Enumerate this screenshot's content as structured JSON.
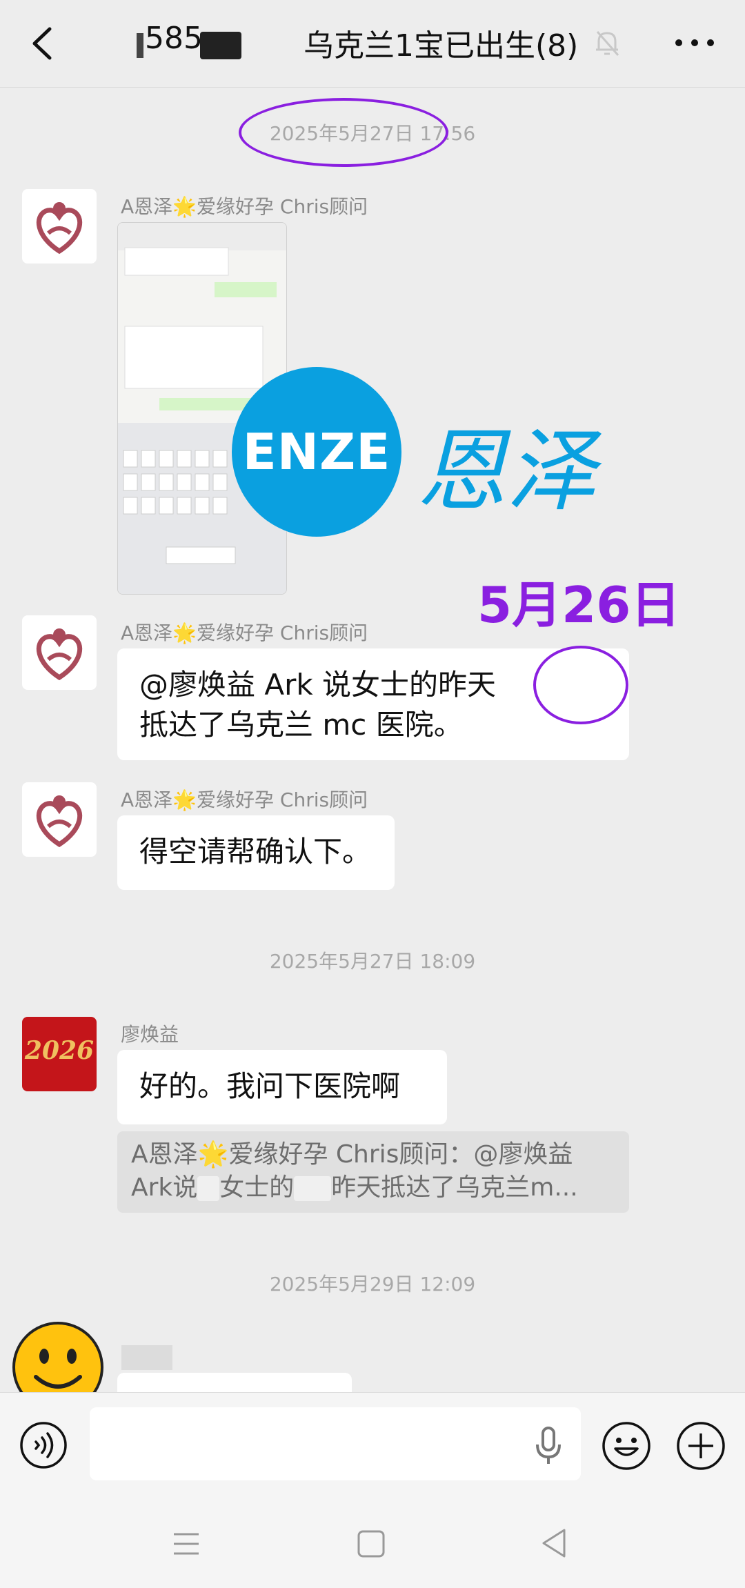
{
  "header": {
    "group_id_partial": "585",
    "group_title": "乌克兰1宝已出生(8)"
  },
  "messages": {
    "ts1": "2025年5月27日 17:56",
    "sender_chris": "A恩泽🌟爱缘好孕 Chris顾问",
    "msg2_line1_a": "@廖焕益  Ark 说",
    "msg2_line1_blur": "  ",
    "msg2_line1_b": "女士的",
    "msg2_line1_blur2": "   ",
    "msg2_line1_c": "昨天",
    "msg2_line2": "抵达了乌克兰 mc 医院。",
    "msg3": "得空请帮确认下。",
    "ts2": "2025年5月27日 18:09",
    "sender_liao": "廖焕益",
    "avatar_liao_text": "2026",
    "msg4": "好的。我问下医院啊",
    "quote_line1": "A恩泽🌟爱缘好孕 Chris顾问：@廖焕益",
    "quote_line2_a": "Ark说",
    "quote_line2_b": "女士的",
    "quote_line2_c": "昨天抵达了乌克兰m...",
    "ts3": "2025年5月29日 12:09"
  },
  "watermark": {
    "brand_en": "ENZE",
    "brand_cn": "恩泽",
    "date_label": "5月26日"
  },
  "colors": {
    "accent_purple": "#8a1fe0",
    "brand_blue": "#0aa0e0",
    "bg": "#ededed"
  }
}
